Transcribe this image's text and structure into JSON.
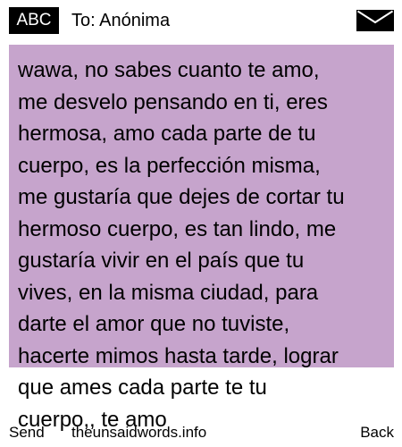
{
  "header": {
    "input_mode": "ABC",
    "recipient": "To: Anónima",
    "envelope_icon": "envelope-icon"
  },
  "message": {
    "text": "wawa, no sabes cuanto te amo,\nme desvelo pensando en ti, eres\nhermosa, amo cada parte de tu\ncuerpo, es la perfección misma,\nme gustaría que dejes de cortar tu\nhermoso cuerpo, es tan lindo, me\ngustaría vivir en el país que tu\nvives, en la misma ciudad, para\ndarte el amor que no tuviste,\nhacerte mimos hasta tarde, lograr\nque ames cada parte te tu\ncuerpo,, te amo"
  },
  "softkeys": {
    "left": "Send",
    "center": "theunsaidwords.info",
    "right": "Back"
  },
  "colors": {
    "highlight": "#c6a4cc",
    "background": "#ffffff",
    "text": "#000000",
    "mode_badge_bg": "#000000",
    "mode_badge_text": "#ffffff"
  }
}
